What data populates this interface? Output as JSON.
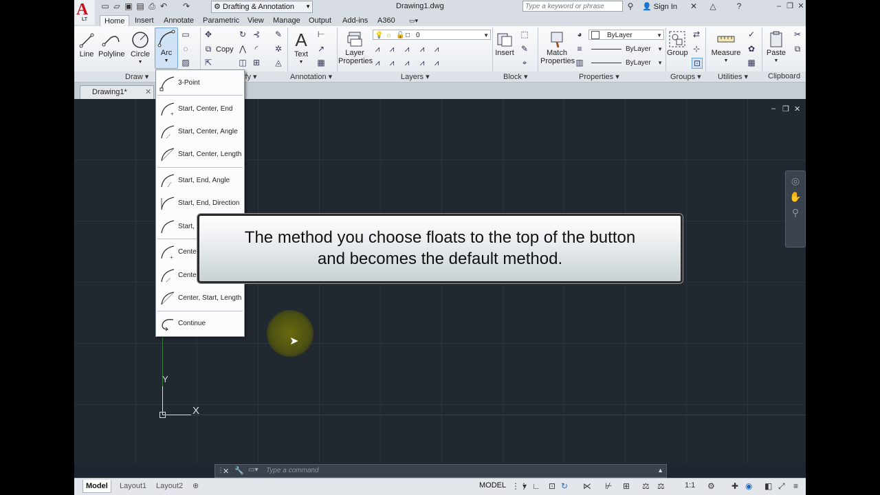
{
  "app": {
    "logo_text": "A",
    "logo_sub": "LT"
  },
  "titlebar": {
    "workspace": "Drafting & Annotation",
    "doc_title": "Drawing1.dwg",
    "search_placeholder": "Type a keyword or phrase",
    "sign_in": "Sign In"
  },
  "tabs": [
    "Home",
    "Insert",
    "Annotate",
    "Parametric",
    "View",
    "Manage",
    "Output",
    "Add-ins",
    "A360"
  ],
  "ribbon": {
    "draw": {
      "line": "Line",
      "polyline": "Polyline",
      "circle": "Circle",
      "arc": "Arc"
    },
    "modify": {
      "copy": "Copy"
    },
    "annotation": {
      "text": "Text"
    },
    "layers": {
      "layer_properties": [
        "Layer",
        "Properties"
      ],
      "layer_value": "0"
    },
    "block": {
      "insert": "Insert"
    },
    "properties": {
      "match": [
        "Match",
        "Properties"
      ],
      "color": "ByLayer",
      "linetype": "ByLayer",
      "lineweight": "ByLayer"
    },
    "groups": {
      "group": "Group"
    },
    "utilities": {
      "measure": "Measure"
    },
    "clipboard": {
      "paste": "Paste"
    },
    "panel_labels": {
      "draw": "Draw",
      "modify": "ify",
      "annotation": "Annotation",
      "layers": "Layers",
      "block": "Block",
      "properties": "Properties",
      "groups": "Groups",
      "utilities": "Utilities",
      "clipboard": "Clipboard"
    }
  },
  "doc_tab": {
    "label": "Drawing1*"
  },
  "arc_menu": {
    "items": [
      "3-Point",
      "Start, Center, End",
      "Start, Center, Angle",
      "Start, Center, Length",
      "Start, End, Angle",
      "Start, End, Direction",
      "Start, E",
      "Center",
      "Center",
      "Center, Start, Length",
      "Continue"
    ]
  },
  "callout": {
    "line1": "The method you choose floats to the top of the button",
    "line2": "and becomes the default method."
  },
  "ucs": {
    "x": "X",
    "y": "Y"
  },
  "command": {
    "placeholder": "Type a command"
  },
  "status": {
    "tabs": [
      "Model",
      "Layout1",
      "Layout2"
    ],
    "model_label": "MODEL",
    "scale": "1:1"
  },
  "colors": {
    "canvas": "#212830",
    "accent_red": "#c8101e",
    "ribbon_bg": "#f0f3f6"
  }
}
